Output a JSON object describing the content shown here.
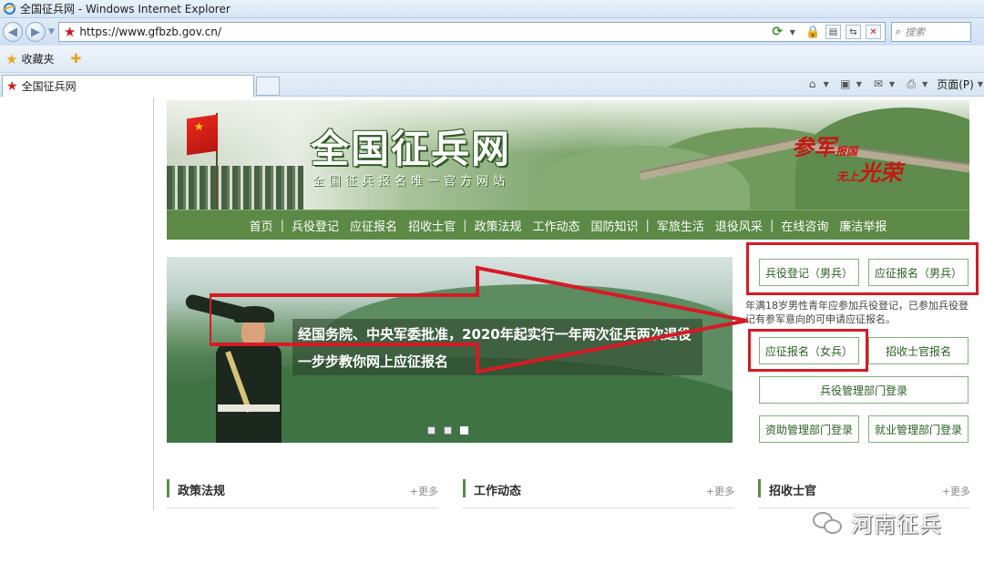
{
  "browser": {
    "window_title": "全国征兵网 - Windows Internet Explorer",
    "url": "https://www.gfbzb.gov.cn/",
    "search_placeholder": "搜索",
    "favorites_label": "收藏夹",
    "tab_title": "全国征兵网",
    "page_menu_label": "页面(P)"
  },
  "site": {
    "title": "全国征兵网",
    "subtitle": "全国征兵报名唯一官方网站",
    "slogan_1_big": "参军",
    "slogan_1_small": "报国",
    "slogan_2_small": "无上",
    "slogan_2_big": "光荣"
  },
  "nav": {
    "items": [
      "首页",
      "兵役登记",
      "应征报名",
      "招收士官",
      "政策法规",
      "工作动态",
      "国防知识",
      "军旅生活",
      "退役风采",
      "在线咨询",
      "廉洁举报"
    ]
  },
  "slide": {
    "caption_line1": "经国务院、中央军委批准，2020年起实行一年两次征兵两次退役",
    "caption_line2": "一步步教你网上应征报名",
    "active_dot": 3,
    "dot_count": 3
  },
  "side": {
    "btn_register_male": "兵役登记（男兵）",
    "btn_apply_male": "应征报名（男兵）",
    "note": "年满18岁男性青年应参加兵役登记，已参加兵役登记有参军意向的可申请应征报名。",
    "btn_apply_female": "应征报名（女兵）",
    "btn_nco": "招收士官报名",
    "btn_dept_login": "兵役管理部门登录",
    "btn_aid_login": "资助管理部门登录",
    "btn_employ_login": "就业管理部门登录"
  },
  "sections": {
    "policy_title": "政策法规",
    "work_title": "工作动态",
    "nco_title": "招收士官",
    "more_label": "+更多"
  },
  "watermark": "河南征兵",
  "colors": {
    "nav_green": "#5c8a46",
    "annotation_red": "#d61a26",
    "button_text_green": "#285f22"
  }
}
